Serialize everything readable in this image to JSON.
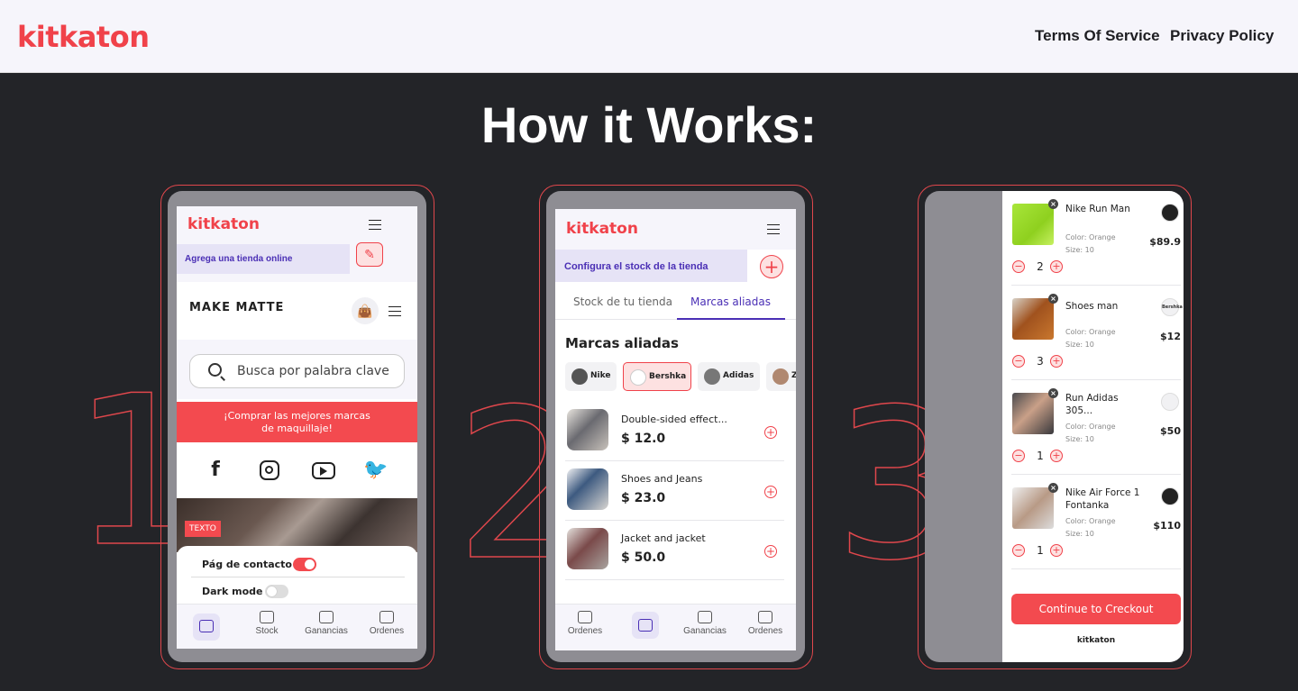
{
  "nav": {
    "brand": "kitkaton",
    "terms": "Terms Of Service",
    "privacy": "Privacy Policy"
  },
  "page": {
    "title": "How it Works:",
    "step_numbers": [
      "1",
      "2",
      "3"
    ]
  },
  "colors": {
    "accent": "#f0424a",
    "purple": "#4a2fb5",
    "background": "#232428"
  },
  "phone1": {
    "brand": "kitkaton",
    "banner": "Agrega una tienda online",
    "store_name": "MAKE MATTE",
    "search_placeholder": "Busca por palabra clave",
    "promo_line1": "¡Comprar las mejores marcas",
    "promo_line2": "de maquillaje!",
    "social_icons": [
      "facebook-icon",
      "instagram-icon",
      "youtube-icon",
      "twitter-icon"
    ],
    "badge": "TEXTO",
    "toggles": [
      {
        "label": "Pág de contacto",
        "on": true
      },
      {
        "label": "Dark mode",
        "on": false
      }
    ],
    "tabs": [
      "",
      "Stock",
      "Ganancias",
      "Ordenes"
    ]
  },
  "phone2": {
    "brand": "kitkaton",
    "banner": "Configura el stock de la tienda",
    "tabs": [
      "Stock de tu tienda",
      "Marcas aliadas"
    ],
    "section_title": "Marcas aliadas",
    "brands": [
      "Nike",
      "Bershka",
      "Adidas",
      "Z"
    ],
    "products": [
      {
        "name": "Double-sided effect...",
        "price": "$ 12.0"
      },
      {
        "name": "Shoes and Jeans",
        "price": "$ 23.0"
      },
      {
        "name": "Jacket and jacket",
        "price": "$ 50.0"
      }
    ],
    "nav_tabs": [
      "Ordenes",
      "",
      "Ganancias",
      "Ordenes"
    ]
  },
  "phone3": {
    "items": [
      {
        "name": "Nike Run Man",
        "color": "Color: Orange",
        "size": "Size: 10",
        "price": "$89.9",
        "qty": "2",
        "logo": ""
      },
      {
        "name": "Shoes man",
        "color": "Color: Orange",
        "size": "Size: 10",
        "price": "$12",
        "qty": "3",
        "logo": "Bershka"
      },
      {
        "name": "Run Adidas 305...",
        "color": "Color: Orange",
        "size": "Size: 10",
        "price": "$50",
        "qty": "1",
        "logo": ""
      },
      {
        "name": "Nike Air Force 1 Fontanka",
        "color": "Color: Orange",
        "size": "Size: 10",
        "price": "$110",
        "qty": "1",
        "logo": ""
      }
    ],
    "checkout": "Continue to Creckout",
    "footer_brand": "kitkaton"
  }
}
